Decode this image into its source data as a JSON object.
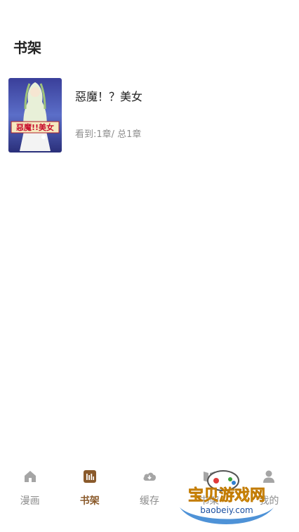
{
  "header": {
    "title": "书架"
  },
  "shelf": {
    "items": [
      {
        "title": "惡魔！？美女",
        "progress": "看到:1章/ 总1章",
        "cover_text": "惡魔!!美女"
      }
    ]
  },
  "tabbar": {
    "active_color": "#8a5a2b",
    "inactive_color": "#8e8e8e",
    "tabs": [
      {
        "label": "漫画",
        "icon": "home-icon",
        "active": false
      },
      {
        "label": "书架",
        "icon": "bookshelf-icon",
        "active": true
      },
      {
        "label": "缓存",
        "icon": "cloud-download-icon",
        "active": false
      },
      {
        "label": "书架",
        "icon": "book-icon",
        "active": false
      },
      {
        "label": "我的",
        "icon": "user-icon",
        "active": false
      }
    ]
  },
  "watermark": {
    "title": "宝贝游戏网",
    "url": "baobeiy.com"
  }
}
